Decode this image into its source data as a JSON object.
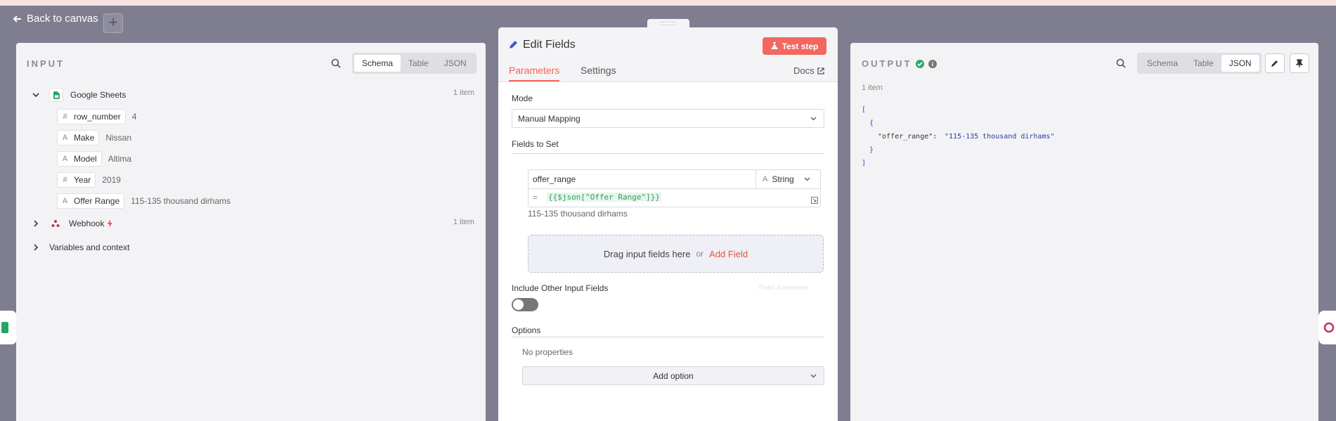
{
  "nav": {
    "back_label": "Back to canvas",
    "add_label": "+"
  },
  "input": {
    "title": "INPUT",
    "tabs": [
      "Schema",
      "Table",
      "JSON"
    ],
    "active_tab": "Schema",
    "nodes": [
      {
        "name": "Google Sheets",
        "count": "1 item",
        "expanded": true
      },
      {
        "name": "Webhook",
        "count": "1 item",
        "expanded": false
      },
      {
        "name": "Variables and context",
        "count": "",
        "expanded": false
      }
    ],
    "fields": [
      {
        "type": "#",
        "name": "row_number",
        "value": "4"
      },
      {
        "type": "A",
        "name": "Make",
        "value": "Nissan"
      },
      {
        "type": "A",
        "name": "Model",
        "value": "Altima"
      },
      {
        "type": "#",
        "name": "Year",
        "value": "2019"
      },
      {
        "type": "A",
        "name": "Offer Range",
        "value": "115-135 thousand dirhams"
      }
    ]
  },
  "editor": {
    "title": "Edit Fields",
    "test_button": "Test step",
    "tabs": [
      "Parameters",
      "Settings"
    ],
    "docs_label": "Docs",
    "mode_label": "Mode",
    "mode_value": "Manual Mapping",
    "fields_to_set_label": "Fields to Set",
    "field": {
      "name": "offer_range",
      "type": "String",
      "type_icon": "A",
      "eq": "=",
      "expression": "{{$json[\"Offer Range\"]}}",
      "preview": "115-135 thousand dirhams"
    },
    "drop_text": "Drag input fields here",
    "drop_or": "or",
    "add_field": "Add Field",
    "include_label": "Include Other Input Fields",
    "include_enabled": false,
    "fixed_label": "Fixed",
    "expression_label": "Expression",
    "options_label": "Options",
    "no_properties": "No properties",
    "add_option": "Add option"
  },
  "output": {
    "title": "OUTPUT",
    "tabs": [
      "Schema",
      "Table",
      "JSON"
    ],
    "active_tab": "JSON",
    "item_count": "1 item",
    "json": {
      "open_bracket": "[",
      "open_brace": "{",
      "key": "\"offer_range\":",
      "value": "\"115-135 thousand dirhams\"",
      "close_brace": "}",
      "close_bracket": "]"
    }
  },
  "colors": {
    "accent": "#f26355",
    "success": "#2ea86a",
    "json_key": "#333333",
    "json_value": "#2b3aa8",
    "json_bracket": "#3b46b2"
  }
}
